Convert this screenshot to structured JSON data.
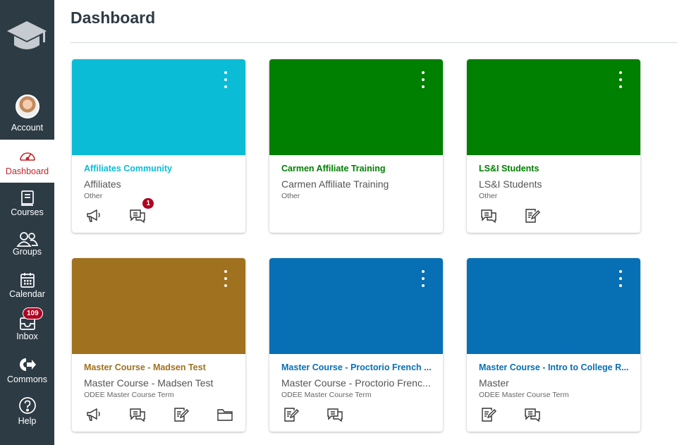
{
  "nav": {
    "items": [
      {
        "label": "Account"
      },
      {
        "label": "Dashboard"
      },
      {
        "label": "Courses"
      },
      {
        "label": "Groups"
      },
      {
        "label": "Calendar"
      },
      {
        "label": "Inbox",
        "badge": "109"
      },
      {
        "label": "Commons"
      },
      {
        "label": "Help"
      }
    ]
  },
  "page": {
    "title": "Dashboard"
  },
  "cards": [
    {
      "color": "#0bbcd6",
      "name_color": "#0bbcd6",
      "name": "Affiliates Community",
      "code": "Affiliates",
      "term": "Other",
      "discussion_badge": "1"
    },
    {
      "color": "#008000",
      "name_color": "#008000",
      "name": "Carmen Affiliate Training",
      "code": "Carmen Affiliate Training",
      "term": "Other"
    },
    {
      "color": "#008000",
      "name_color": "#008000",
      "name": "LS&I Students",
      "code": "LS&I Students",
      "term": "Other"
    },
    {
      "color": "#a0711e",
      "name_color": "#a0711e",
      "name": "Master Course - Madsen Test",
      "code": "Master Course - Madsen Test",
      "term": "ODEE Master Course Term"
    },
    {
      "color": "#0770b5",
      "name_color": "#0770b5",
      "name": "Master Course - Proctorio French ...",
      "code": "Master Course - Proctorio Frenc...",
      "term": "ODEE Master Course Term"
    },
    {
      "color": "#0770b5",
      "name_color": "#0770b5",
      "name": "Master Course - Intro to College R...",
      "code": "Master",
      "term": "ODEE Master Course Term"
    }
  ],
  "colors": {
    "nav_bg": "#2d3b45",
    "active_label": "#c1272d",
    "badge": "#b00020"
  },
  "icons": [
    "logo-icon",
    "dashboard-icon",
    "courses-icon",
    "groups-icon",
    "calendar-icon",
    "inbox-icon",
    "commons-icon",
    "help-icon",
    "announcements-icon",
    "discussions-icon",
    "assignments-icon",
    "files-icon",
    "kebab-menu-icon"
  ]
}
